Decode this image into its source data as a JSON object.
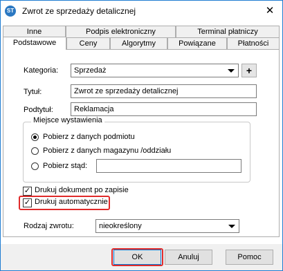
{
  "window": {
    "title": "Zwrot ze sprzedaży detalicznej",
    "app_icon_text": "ST",
    "close_glyph": "✕"
  },
  "tabs_row1": [
    {
      "label": "Inne"
    },
    {
      "label": "Podpis elektroniczny"
    },
    {
      "label": "Terminal płatniczy"
    }
  ],
  "tabs_row2": [
    {
      "label": "Podstawowe",
      "active": true
    },
    {
      "label": "Ceny"
    },
    {
      "label": "Algorytmy"
    },
    {
      "label": "Powiązane"
    },
    {
      "label": "Płatności"
    }
  ],
  "form": {
    "kategoria_label": "Kategoria:",
    "kategoria_value": "Sprzedaż",
    "add_label": "+",
    "tytul_label": "Tytuł:",
    "tytul_value": "Zwrot ze sprzedaży detalicznej",
    "podtytul_label": "Podtytuł:",
    "podtytul_value": "Reklamacja",
    "group_title": "Miejsce wystawienia",
    "radio1_label": "Pobierz z danych podmiotu",
    "radio1_selected": true,
    "radio2_label": "Pobierz z danych magazynu /oddziału",
    "radio3_label": "Pobierz stąd:",
    "radio3_value": "",
    "chk1_label": "Drukuj dokument po zapisie",
    "chk1_checked": true,
    "chk2_label": "Drukuj automatycznie",
    "chk2_checked": true,
    "rodzaj_label": "Rodzaj zwrotu:",
    "rodzaj_value": "nieokreślony"
  },
  "buttons": {
    "ok": "OK",
    "cancel": "Anuluj",
    "help": "Pomoc"
  },
  "colors": {
    "highlight": "#e02a2a",
    "accent": "#0078d7"
  }
}
